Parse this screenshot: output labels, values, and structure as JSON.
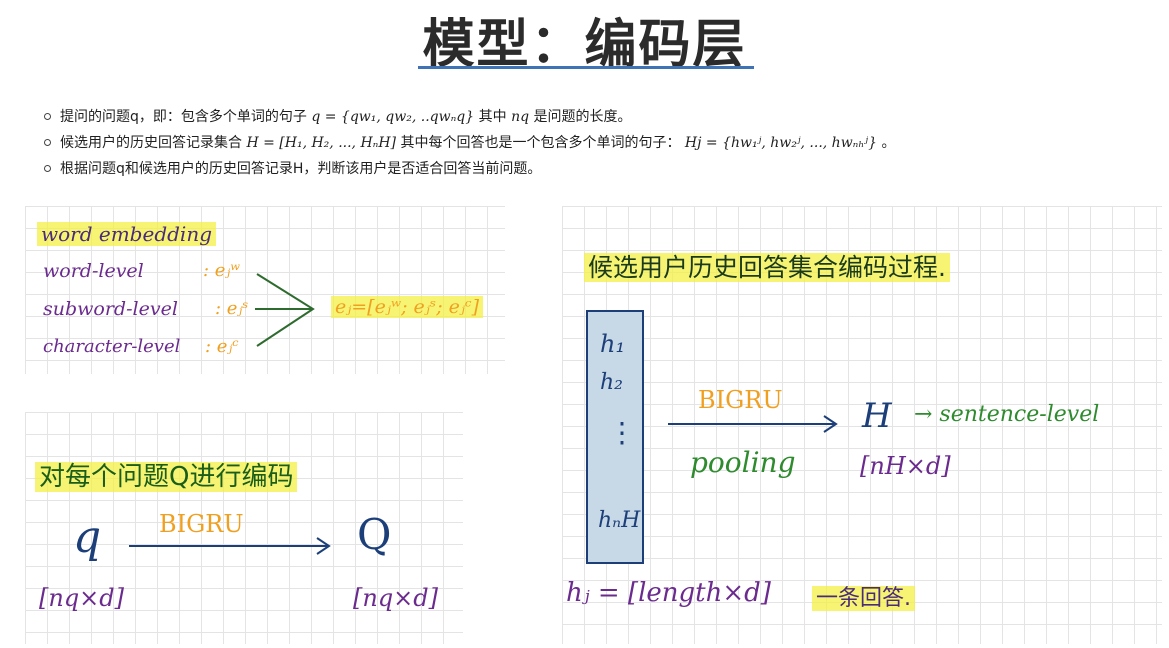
{
  "title": "模型：编码层",
  "bullets": [
    {
      "pre": "提问的问题q，即：包含多个单词的句子",
      "formula": "q = {qw₁, qw₂, ..qwₙq}",
      "mid": " 其中",
      "var": "nq",
      "post": " 是问题的长度。"
    },
    {
      "pre": "候选用户的历史回答记录集合",
      "formula": "H = [H₁, H₂, ..., HₙH]",
      "mid": " 其中每个回答也是一个包含多个单词的句子：",
      "var": "Hj = {hw₁ʲ, hw₂ʲ, ..., hwₙₕʲ}",
      "post": "。"
    },
    {
      "pre": "根据问题q和候选用户的历史回答记录H，判断该用户是否适合回答当前问题。"
    }
  ],
  "panel1": {
    "heading": "word embedding",
    "rows": [
      {
        "label": "word-level",
        "sym": ": eⱼʷ"
      },
      {
        "label": "subword-level",
        "sym": ": eⱼˢ"
      },
      {
        "label": "character-level",
        "sym": ": eⱼᶜ"
      }
    ],
    "result": "eⱼ=[eⱼʷ; eⱼˢ; eⱼᶜ]"
  },
  "panel2": {
    "heading": "对每个问题Q进行编码",
    "input": "q",
    "op": "BIGRU",
    "output": "Q",
    "input_dim": "[nq×d]",
    "output_dim": "[nq×d]"
  },
  "panel3": {
    "heading": "候选用户历史回答集合编码过程.",
    "stack": [
      "h₁",
      "h₂",
      "⋮",
      "hₙH"
    ],
    "op_top": "BIGRU",
    "op_bottom": "pooling",
    "output": "H",
    "output_note": "→ sentence-level",
    "output_dim": "[nH×d]",
    "hj_def": "hⱼ = [length×d]",
    "hj_note": "一条回答."
  }
}
